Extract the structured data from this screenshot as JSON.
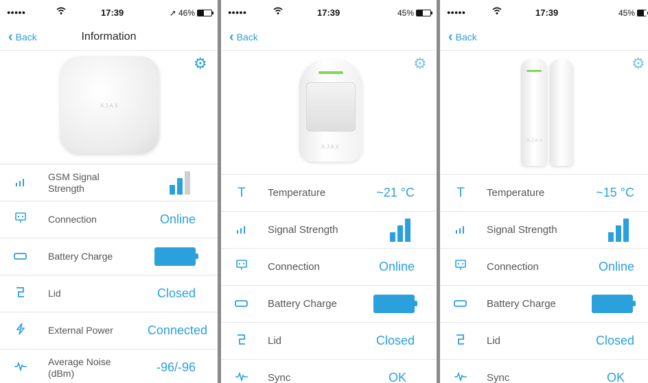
{
  "status": {
    "dots": "●●●●●",
    "time": "17:39"
  },
  "screens": [
    {
      "battery_percent": "46%",
      "location_arrow": "➚",
      "back_label": "Back",
      "title": "Information",
      "device_logo": "AJAX",
      "rows": [
        {
          "label": "GSM Signal Strength",
          "icon": "signal-icon",
          "signal_level": 2,
          "signal_max": 3
        },
        {
          "label": "Connection",
          "icon": "connection-icon",
          "value": "Online"
        },
        {
          "label": "Battery Charge",
          "icon": "battery-icon",
          "value": "100%"
        },
        {
          "label": "Lid",
          "icon": "lid-icon",
          "value": "Closed"
        },
        {
          "label": "External Power",
          "icon": "power-icon",
          "value": "Connected"
        },
        {
          "label": "Average Noise (dBm)",
          "icon": "noise-icon",
          "value": "-96/-96"
        }
      ]
    },
    {
      "battery_percent": "45%",
      "back_label": "Back",
      "device_logo": "AJAX",
      "rows": [
        {
          "label": "Temperature",
          "icon": "temperature-icon",
          "value": "~21 °C"
        },
        {
          "label": "Signal Strength",
          "icon": "signal-icon",
          "signal_level": 3,
          "signal_max": 3
        },
        {
          "label": "Connection",
          "icon": "connection-icon",
          "value": "Online"
        },
        {
          "label": "Battery Charge",
          "icon": "battery-icon",
          "value": "100%"
        },
        {
          "label": "Lid",
          "icon": "lid-icon",
          "value": "Closed"
        },
        {
          "label": "Sync",
          "icon": "sync-icon",
          "value": "OK"
        }
      ]
    },
    {
      "battery_percent": "45%",
      "back_label": "Back",
      "device_logo": "AJAX",
      "rows": [
        {
          "label": "Temperature",
          "icon": "temperature-icon",
          "value": "~15 °C"
        },
        {
          "label": "Signal Strength",
          "icon": "signal-icon",
          "signal_level": 3,
          "signal_max": 3
        },
        {
          "label": "Connection",
          "icon": "connection-icon",
          "value": "Online"
        },
        {
          "label": "Battery Charge",
          "icon": "battery-icon",
          "value": "100%"
        },
        {
          "label": "Lid",
          "icon": "lid-icon",
          "value": "Closed"
        },
        {
          "label": "Sync",
          "icon": "sync-icon",
          "value": "OK"
        }
      ]
    }
  ],
  "colors": {
    "accent": "#2aa0dd",
    "led": "#7ed957",
    "divider": "#8a8a8a"
  }
}
